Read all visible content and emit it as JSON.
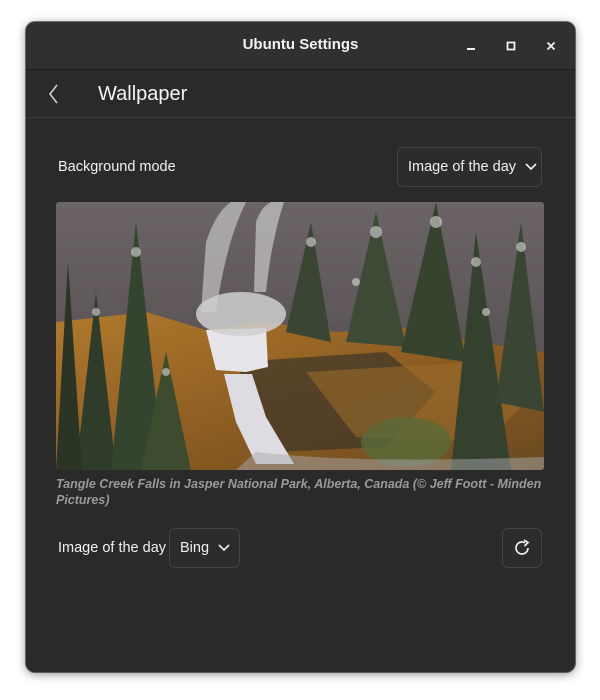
{
  "window": {
    "title": "Ubuntu Settings",
    "controls": [
      "minimize-icon",
      "maximize-icon",
      "close-icon"
    ]
  },
  "header": {
    "back_icon": "chevron-left-icon",
    "page_title": "Wallpaper"
  },
  "background_mode": {
    "label": "Background mode",
    "selected": "Image of the day"
  },
  "wallpaper": {
    "caption": "Tangle Creek Falls in Jasper National Park, Alberta, Canada (© Jeff Foott - Minden Pictures)"
  },
  "image_of_day": {
    "label": "Image of the day",
    "provider": "Bing",
    "refresh_icon": "refresh-icon"
  },
  "colors": {
    "window_bg": "#2a2a2a",
    "titlebar_bg": "#303030",
    "text": "#f0f0f0",
    "caption_text": "#9a9a9a"
  }
}
